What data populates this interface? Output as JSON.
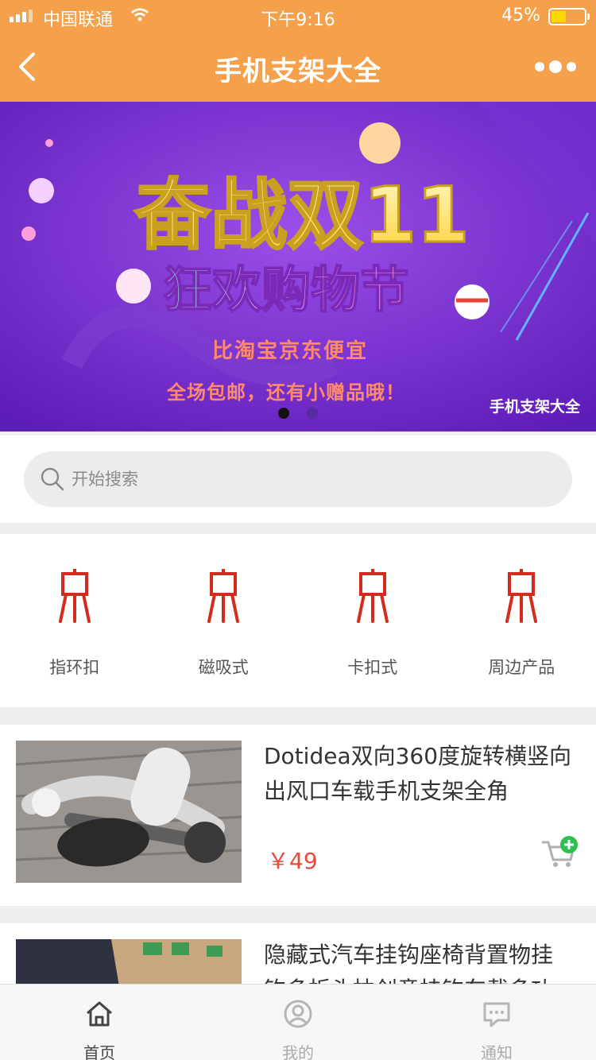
{
  "status_bar": {
    "carrier": "中国联通",
    "time": "下午9:16",
    "battery_percent": "45%",
    "battery_level": 0.45
  },
  "nav": {
    "title": "手机支架大全"
  },
  "banner": {
    "headline": "奋战双11",
    "subheadline": "狂欢购物节",
    "line1": "比淘宝京东便宜",
    "line2": "全场包邮，还有小赠品哦！",
    "watermark": "手机支架大全",
    "slide_count": 2,
    "active_slide": 0
  },
  "search": {
    "placeholder": "开始搜索"
  },
  "categories": [
    {
      "label": "指环扣",
      "icon": "easel-icon"
    },
    {
      "label": "磁吸式",
      "icon": "easel-icon"
    },
    {
      "label": "卡扣式",
      "icon": "easel-icon"
    },
    {
      "label": "周边产品",
      "icon": "easel-icon"
    }
  ],
  "products": [
    {
      "name": "Dotidea双向360度旋转横竖向出风口车载手机支架全角",
      "price": "￥49"
    },
    {
      "name": "隐藏式汽车挂钩座椅背置物挂钩多折头枕创意挂钩车载多功"
    }
  ],
  "tabs": [
    {
      "label": "首页",
      "icon": "home-icon",
      "active": true
    },
    {
      "label": "我的",
      "icon": "user-icon",
      "active": false
    },
    {
      "label": "通知",
      "icon": "message-icon",
      "active": false
    }
  ],
  "colors": {
    "brand_orange": "#f5a04a",
    "accent_red": "#d42b1f",
    "price_red": "#e84a3a",
    "cart_green": "#2fbf4f"
  }
}
